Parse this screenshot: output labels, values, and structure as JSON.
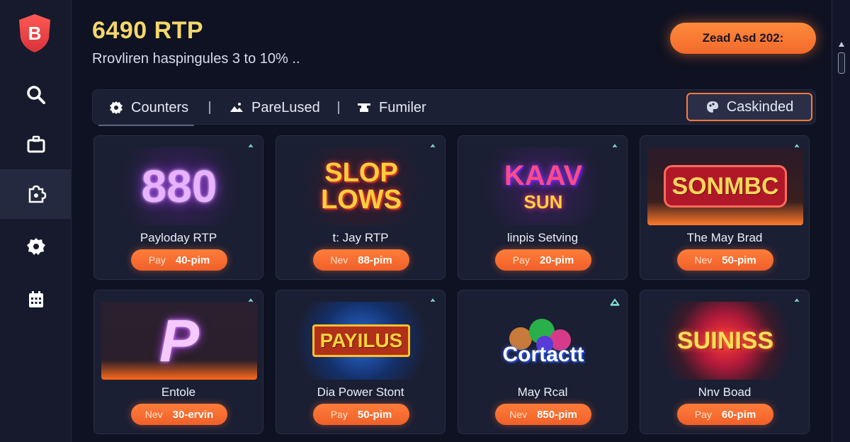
{
  "header": {
    "rtp_title": "6490 RTP",
    "rtp_subtitle": "Rrovliren haspingules 3 to 10% ..",
    "cta_label": "Zead Asd 202:"
  },
  "sidebar": {
    "logo_icon": "shield-logo",
    "items": [
      {
        "icon": "search-icon",
        "active": false
      },
      {
        "icon": "briefcase-icon",
        "active": false
      },
      {
        "icon": "puzzle-icon",
        "active": true
      },
      {
        "icon": "gear-icon",
        "active": false
      },
      {
        "icon": "calendar-icon",
        "active": false
      }
    ]
  },
  "filters": {
    "tabs": [
      {
        "label": "Counters",
        "icon": "gear-icon",
        "active": true
      },
      {
        "label": "PareLused",
        "icon": "landscape-icon",
        "active": false
      },
      {
        "label": "Fumiler",
        "icon": "anvil-icon",
        "active": false
      }
    ],
    "filter_button": "Caskinded"
  },
  "games": [
    {
      "art": "880",
      "name": "Payloday RTP",
      "tag": "Pay",
      "value": "40-pim"
    },
    {
      "art_line1": "SLOP",
      "art_line2": "LOWS",
      "name": "t: Jay RTP",
      "tag": "Nev",
      "value": "88-pim"
    },
    {
      "art_line1": "KAAV",
      "art_line2": "SUN",
      "name": "linpis Setving",
      "tag": "Pay",
      "value": "20-pim"
    },
    {
      "art": "SONMBC",
      "name": "The May Brad",
      "tag": "Nev",
      "value": "50-pim"
    },
    {
      "art": "P",
      "name": "Entole",
      "tag": "Nev",
      "value": "30-ervin"
    },
    {
      "art": "PAYILUS",
      "name": "Dia Power Stont",
      "tag": "Pay",
      "value": "50-pim"
    },
    {
      "art": "Cortactt",
      "name": "May Rcal",
      "tag": "Nev",
      "value": "850-pim"
    },
    {
      "art": "SUINISS",
      "name": "Nnv Boad",
      "tag": "Pay",
      "value": "60-pim"
    }
  ],
  "colors": {
    "accent": "#ff7a3a",
    "title": "#f3d76b",
    "background": "#0f1222",
    "card": "#1b1f33"
  }
}
